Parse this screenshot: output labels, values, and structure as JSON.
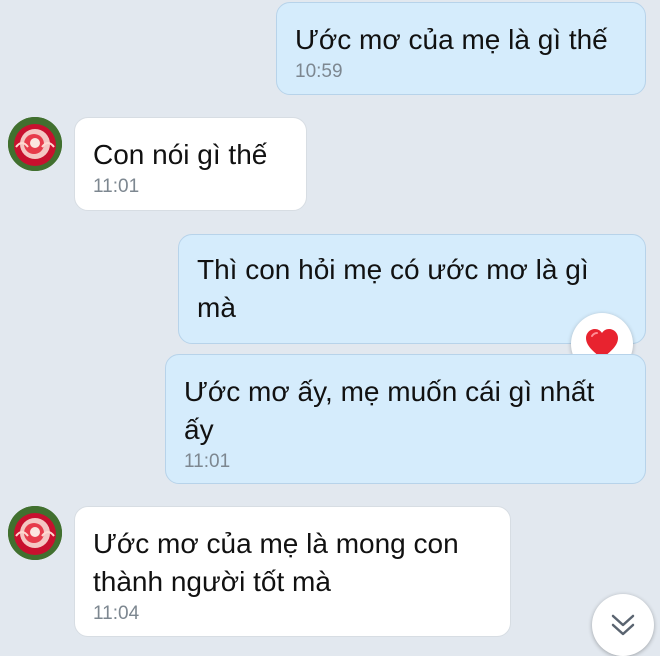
{
  "messages": [
    {
      "text": "Ước mơ của mẹ là gì thế",
      "time": "10:59"
    },
    {
      "text": "Con nói gì thế",
      "time": "11:01"
    },
    {
      "text": "Thì con hỏi mẹ có ước mơ là gì\nmà"
    },
    {
      "text": "Ước mơ ấy, mẹ muốn cái gì nhất\nấy",
      "time": "11:01"
    },
    {
      "text": "Ước mơ của mẹ là mong con\nthành người tốt mà",
      "time": "11:04"
    }
  ],
  "reaction": {
    "icon": "heart-icon",
    "color": "#e8232f"
  },
  "scroll_button": {
    "icon": "double-chevron-down-icon"
  },
  "colors": {
    "outgoing_bubble": "#d5ecfc",
    "incoming_bubble": "#ffffff",
    "background": "#e2e8ef"
  }
}
